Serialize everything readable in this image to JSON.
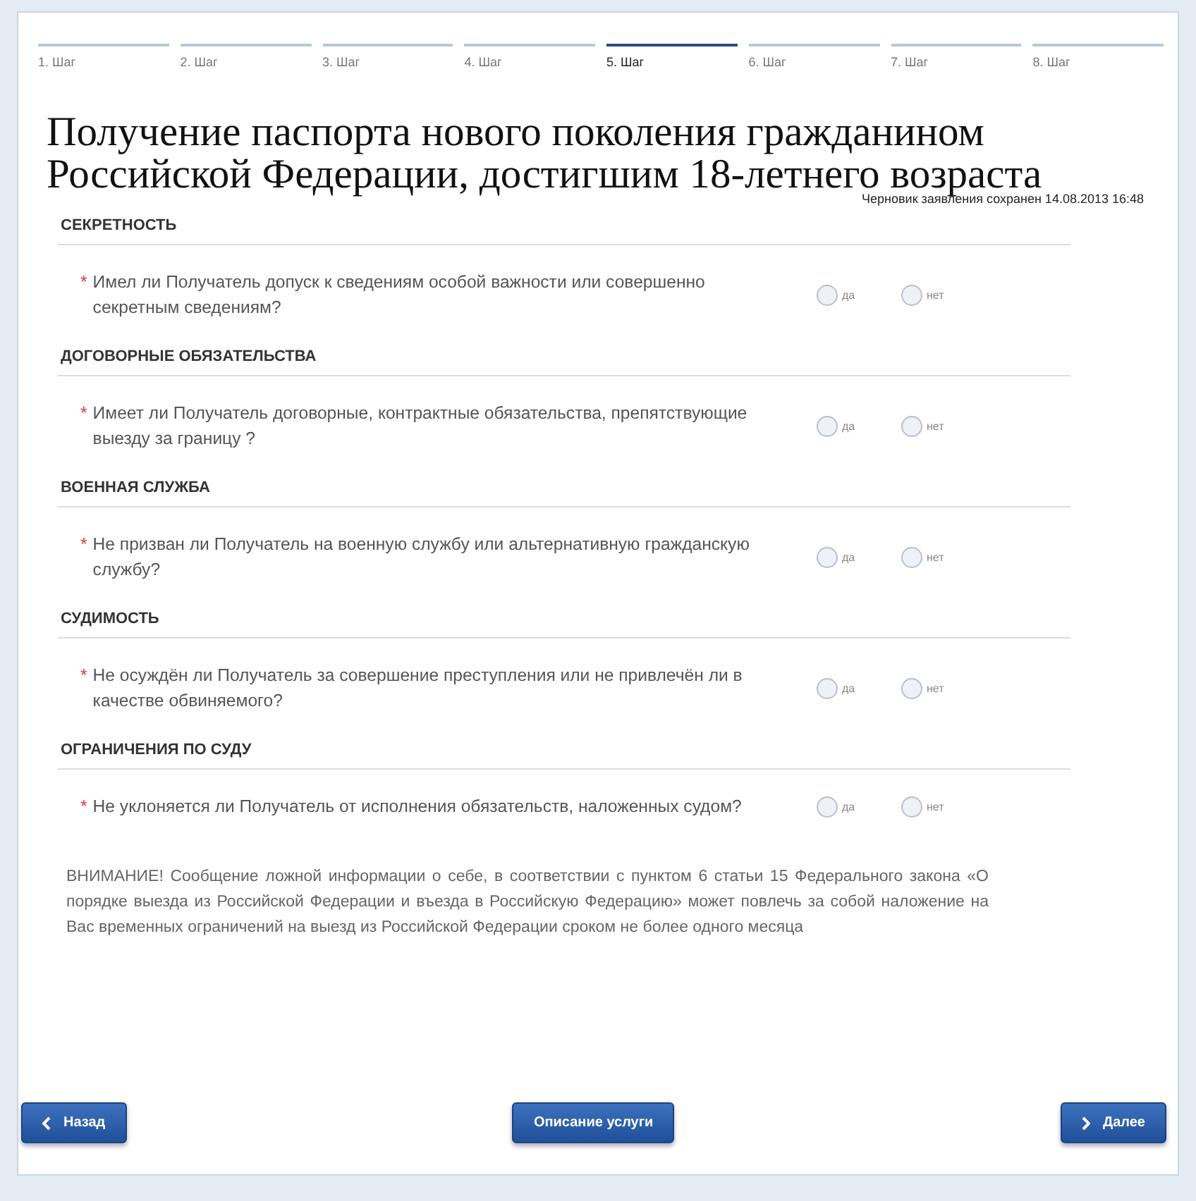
{
  "steps": [
    {
      "label": "1. Шаг",
      "selected": false
    },
    {
      "label": "2. Шаг",
      "selected": false
    },
    {
      "label": "3. Шаг",
      "selected": false
    },
    {
      "label": "4. Шаг",
      "selected": false
    },
    {
      "label": "5. Шаг",
      "selected": true
    },
    {
      "label": "6. Шаг",
      "selected": false
    },
    {
      "label": "7. Шаг",
      "selected": false
    },
    {
      "label": "8. Шаг",
      "selected": false
    }
  ],
  "title": "Получение паспорта нового поколения гражданином Российской Федерации, достигшим 18-летнего возраста",
  "draft_status": "Черновик заявления сохранен  14.08.2013 16:48",
  "sections": [
    {
      "heading": "СЕКРЕТНОСТЬ",
      "question": "Имел ли Получатель допуск к сведениям особой важности или совершенно секретным сведениям?",
      "required_mark": "*",
      "options": [
        {
          "label": "да",
          "selected": false
        },
        {
          "label": "нет",
          "selected": false
        }
      ]
    },
    {
      "heading": "ДОГОВОРНЫЕ ОБЯЗАТЕЛЬСТВА",
      "question": "Имеет ли Получатель договорные, контрактные обязательства, препятствующие выезду за границу ?",
      "required_mark": "*",
      "options": [
        {
          "label": "да",
          "selected": false
        },
        {
          "label": "нет",
          "selected": false
        }
      ]
    },
    {
      "heading": "ВОЕННАЯ СЛУЖБА",
      "question": "Не призван ли Получатель на военную службу или альтернативную гражданскую службу?",
      "required_mark": "*",
      "options": [
        {
          "label": "да",
          "selected": false
        },
        {
          "label": "нет",
          "selected": false
        }
      ]
    },
    {
      "heading": "СУДИМОСТЬ",
      "question": "Не осуждён ли Получатель за совершение преступления или не привлечён ли в качестве обвиняемого?",
      "required_mark": "*",
      "options": [
        {
          "label": "да",
          "selected": false
        },
        {
          "label": "нет",
          "selected": false
        }
      ]
    },
    {
      "heading": "ОГРАНИЧЕНИЯ ПО СУДУ",
      "question": "Не уклоняется ли Получатель от исполнения обязательств, наложенных судом?",
      "required_mark": "*",
      "options": [
        {
          "label": "да",
          "selected": false
        },
        {
          "label": "нет",
          "selected": false
        }
      ]
    }
  ],
  "warning": "ВНИМАНИЕ! Сообщение ложной информации о себе, в соответствии с пунктом 6 статьи 15 Федерального закона «О порядке выезда из Российской Федерации и въезда в Российскую Федерацию» может повлечь за собой наложение на Вас временных ограничений на выезд из Российской Федерации сроком не более одного месяца",
  "buttons": {
    "back": "Назад",
    "description": "Описание услуги",
    "next": "Далее"
  }
}
